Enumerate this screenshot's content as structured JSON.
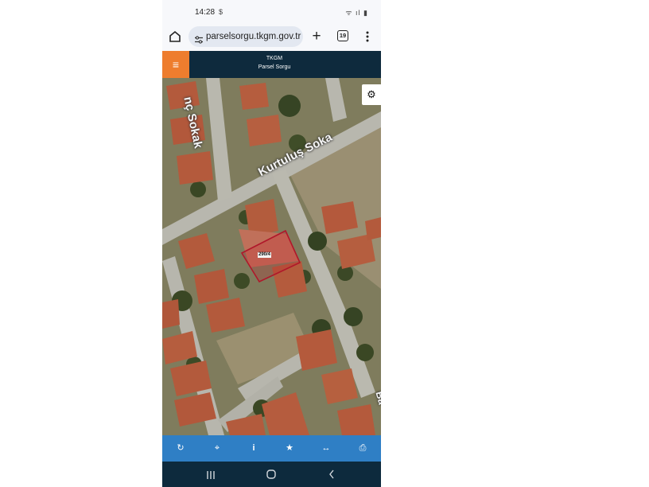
{
  "status": {
    "time": "14:28",
    "extra": "$",
    "icons": "ᯤ ıl ▮"
  },
  "browser": {
    "url": "parselsorgu.tkgm.gov.tr",
    "new_tab": "+",
    "tab_count": "19"
  },
  "header": {
    "menu_icon": "≡",
    "line1": "TKGM",
    "line2": "Parsel Sorgu"
  },
  "map": {
    "settings_icon": "⚙",
    "streets": [
      "nç Sokak",
      "Kurtuluş Soka",
      "Ba"
    ],
    "parcel_label": "290/4",
    "parcel_color": "#b0172a"
  },
  "toolbar": {
    "icons": [
      "↻",
      "⌖",
      "i",
      "★",
      "↔",
      "⎙"
    ]
  },
  "colors": {
    "header_bg": "#0e2a3d",
    "accent": "#ee7d2e",
    "toolbar_bg": "#2f7fc5"
  }
}
